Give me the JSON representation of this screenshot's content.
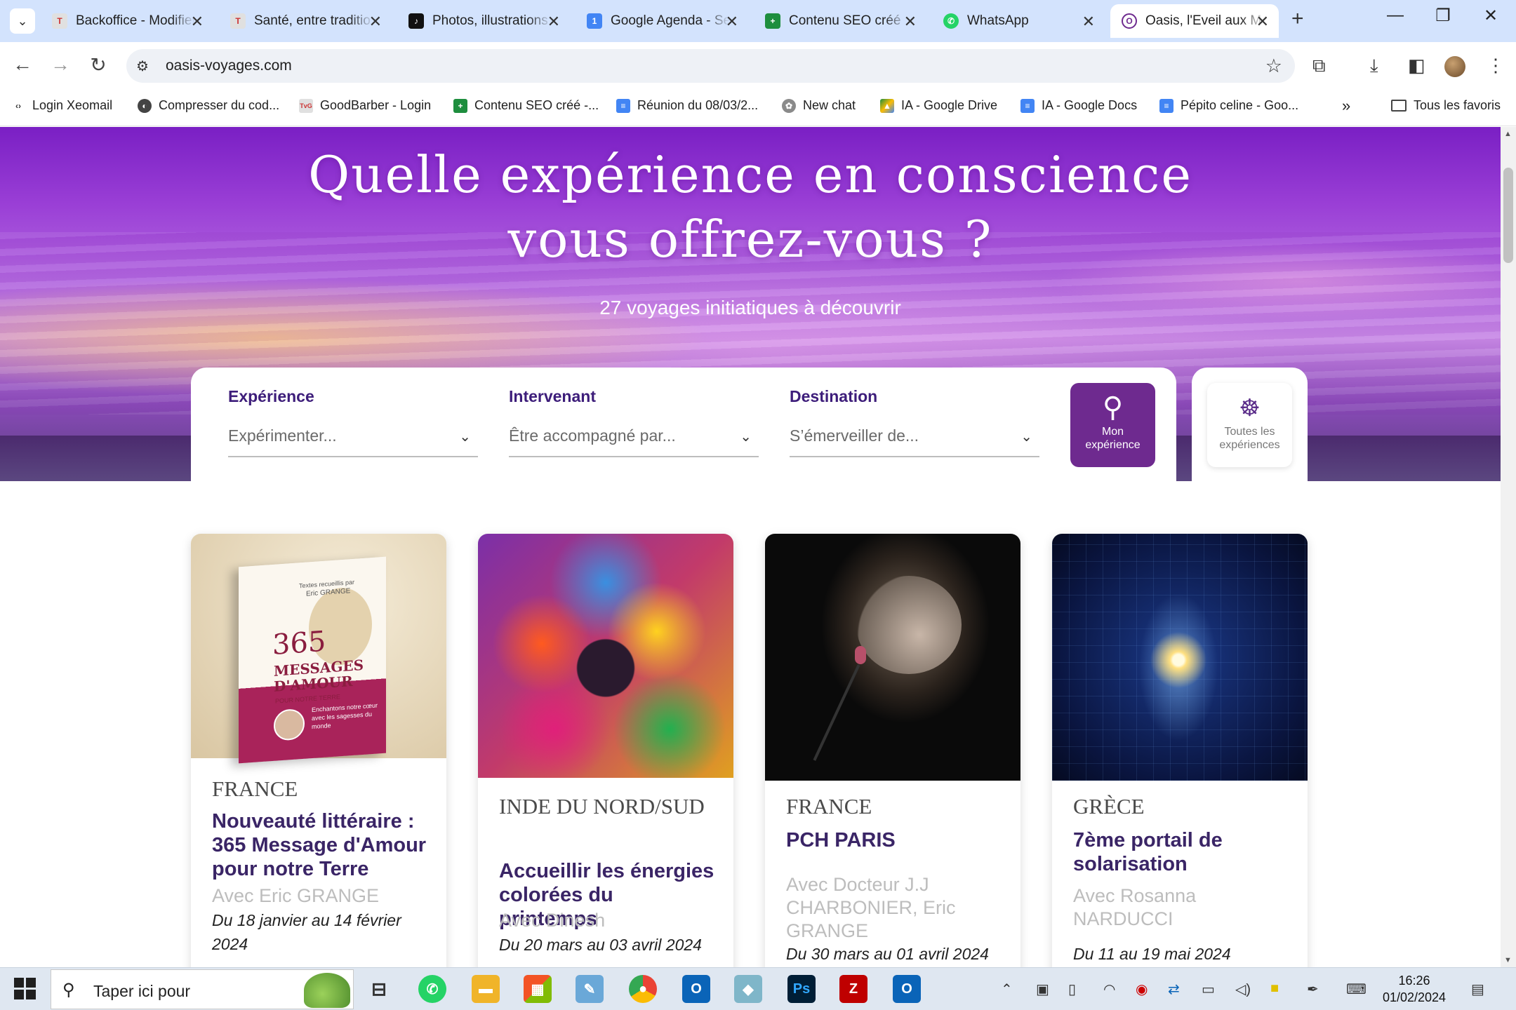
{
  "tabs": [
    {
      "title": "Backoffice - Modifier",
      "favicon": "tvg",
      "color": "#e0e0e0"
    },
    {
      "title": "Santé, entre traditio",
      "favicon": "tvg",
      "color": "#e0e0e0"
    },
    {
      "title": "Photos, illustrations",
      "favicon": "tiktok",
      "color": "#111111"
    },
    {
      "title": "Google Agenda - Se",
      "favicon": "calendar",
      "color": "#4285f4"
    },
    {
      "title": "Contenu SEO créé",
      "favicon": "sheets",
      "color": "#1e8e3e"
    },
    {
      "title": "WhatsApp",
      "favicon": "whatsapp",
      "color": "#25d366"
    },
    {
      "title": "Oasis, l'Eveil aux M",
      "favicon": "oasis",
      "color": "#ffffff"
    }
  ],
  "window": {
    "minimize": "—",
    "restore": "❐",
    "close": "✕"
  },
  "toolbar": {
    "url": "oasis-voyages.com"
  },
  "bookmarks": [
    {
      "label": "Login Xeomail",
      "color": "#333333",
      "glyph": "‹›"
    },
    {
      "label": "Compresser du cod...",
      "color": "#444444",
      "glyph": "◐"
    },
    {
      "label": "GoodBarber - Login",
      "color": "#e0e0e0",
      "glyph": "TvG"
    },
    {
      "label": "Contenu SEO créé -...",
      "color": "#1e8e3e",
      "glyph": "+"
    },
    {
      "label": "Réunion du 08/03/2...",
      "color": "#4285f4",
      "glyph": "≡"
    },
    {
      "label": "New chat",
      "color": "#8a8a8a",
      "glyph": "✿"
    },
    {
      "label": "IA - Google Drive",
      "color": "#fbbc04",
      "glyph": "▲"
    },
    {
      "label": "IA - Google Docs",
      "color": "#4285f4",
      "glyph": "≡"
    },
    {
      "label": "Pépito celine - Goo...",
      "color": "#4285f4",
      "glyph": "≡"
    }
  ],
  "bookmarks_more": "»",
  "bookmarks_all": "Tous les favoris",
  "hero": {
    "title_line1": "Quelle expérience en conscience",
    "title_line2": "vous offrez-vous ?",
    "subtitle": "27 voyages initiatiques à découvrir"
  },
  "search": {
    "experience_label": "Expérience",
    "experience_placeholder": "Expérimenter...",
    "intervenant_label": "Intervenant",
    "intervenant_placeholder": "Être accompagné par...",
    "destination_label": "Destination",
    "destination_placeholder": "S’émerveiller de...",
    "button_line1": "Mon",
    "button_line2": "expérience",
    "all_line1": "Toutes les",
    "all_line2": "expériences"
  },
  "cards": [
    {
      "country": "FRANCE",
      "title": "Nouveauté littéraire : 365 Message d'Amour pour notre Terre",
      "with": "Avec Eric GRANGE",
      "dates": "Du 18 janvier au 14 février 2024",
      "book_author_intro": "Textes recueillis par",
      "book_author": "Eric GRANGE",
      "book_title_num": "365",
      "book_title_1": "MESSAGES",
      "book_title_2": "D'AMOUR",
      "book_title_3": "POUR NOTRE TERRE",
      "book_tagline": "Enchantons notre cœur avec les sagesses du monde"
    },
    {
      "country": "INDE DU NORD/SUD",
      "title": "Accueillir les énergies colorées du printemps",
      "with": "Avec Dinesh",
      "dates": "Du 20 mars au 03 avril 2024"
    },
    {
      "country": "FRANCE",
      "title": "PCH PARIS",
      "with": "Avec Docteur J.J CHARBONIER, Eric GRANGE",
      "dates": "Du 30 mars au 01 avril 2024"
    },
    {
      "country": "GRÈCE",
      "title": "7ème portail de solarisation",
      "with": "Avec Rosanna NARDUCCI",
      "dates": "Du 11 au 19 mai 2024"
    }
  ],
  "taskbar": {
    "search_placeholder": "Taper ici pour",
    "time": "16:26",
    "date": "01/02/2024"
  },
  "colors": {
    "accent": "#3d1d7a",
    "button": "#6e2a8f",
    "chrome_tabs": "#d3e3fd"
  }
}
